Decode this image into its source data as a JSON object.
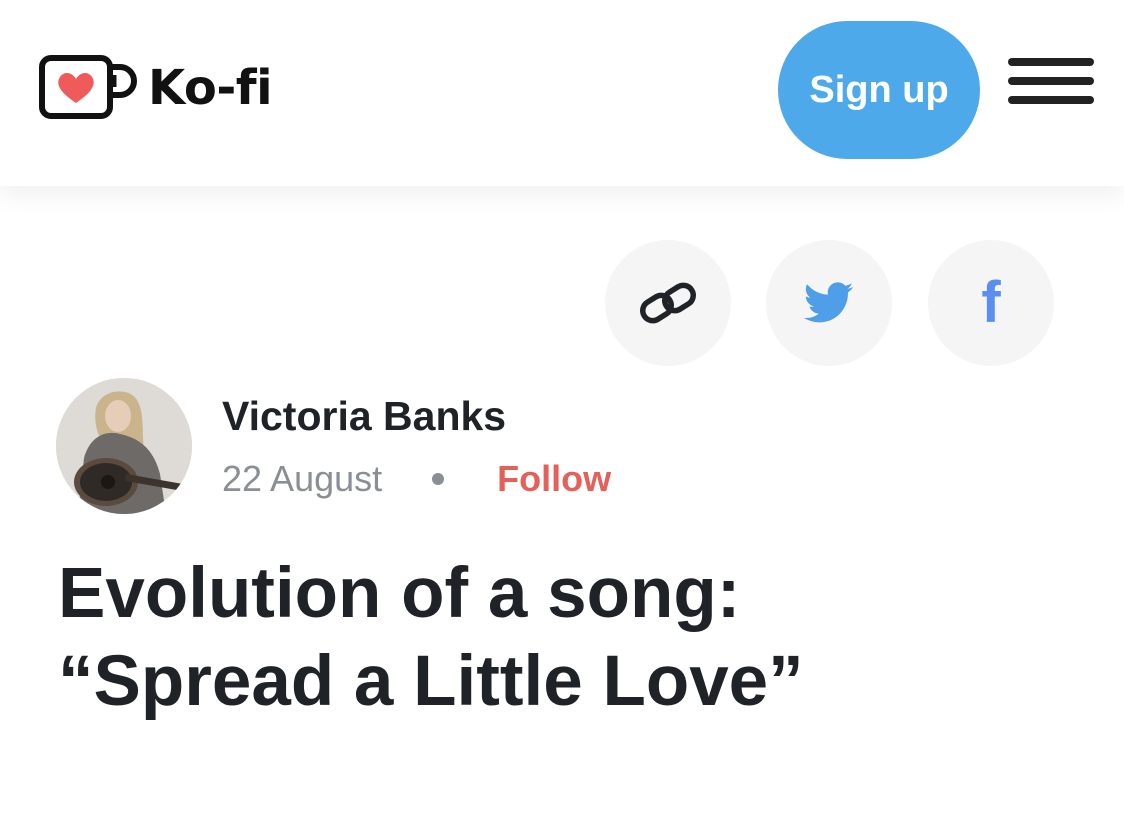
{
  "header": {
    "brand_name": "Ko-fi",
    "logo_icon": "kofi-cup-heart-icon",
    "signup_label": "Sign up",
    "menu_icon": "hamburger-menu-icon"
  },
  "share": {
    "buttons": [
      {
        "icon": "link-icon"
      },
      {
        "icon": "twitter-bird-icon"
      },
      {
        "icon": "facebook-icon",
        "glyph": "f"
      }
    ]
  },
  "post": {
    "author_name": "Victoria Banks",
    "date": "22 August",
    "follow_label": "Follow",
    "title_line1": "Evolution of a song:",
    "title_line2": "“Spread a Little Love”"
  },
  "colors": {
    "signup_bg": "#4ea9eb",
    "follow": "#e36159",
    "heart": "#ef5b5b",
    "facebook": "#5a8ef0",
    "twitter": "#4e9ee8",
    "share_bg": "#f5f5f5",
    "text": "#1f2328",
    "muted": "#8a8f96"
  }
}
